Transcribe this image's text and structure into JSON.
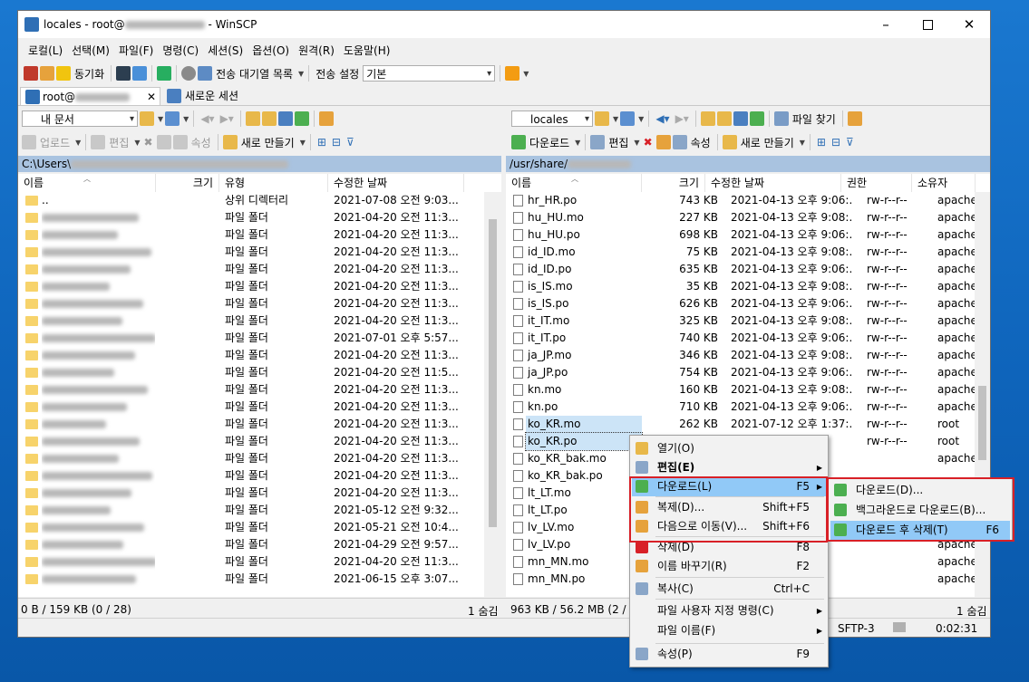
{
  "window": {
    "title_prefix": "locales - root@",
    "title_suffix": " - WinSCP",
    "min_icon": "minimize-icon",
    "max_icon": "maximize-icon",
    "close_icon": "close-icon"
  },
  "menubar": [
    "로컬(L)",
    "선택(M)",
    "파일(F)",
    "명령(C)",
    "세션(S)",
    "옵션(O)",
    "원격(R)",
    "도움말(H)"
  ],
  "toolbar": {
    "sync": "동기화",
    "queue": "전송 대기열 목록",
    "transfer_settings_label": "전송 설정",
    "transfer_settings_value": "기본"
  },
  "tabs": {
    "session": "root@",
    "new_session": "새로운 세션"
  },
  "left": {
    "location": "내 문서",
    "upload": "업로드",
    "edit": "편집",
    "properties": "속성",
    "new": "새로 만들기",
    "path": "C:\\Users\\",
    "headers": [
      "이름",
      "크기",
      "유형",
      "수정한 날짜"
    ],
    "rows": [
      {
        "name": "..",
        "type": "상위 디렉터리",
        "date": "2021-07-08  오전 9:03..."
      },
      {
        "name": "",
        "type": "파일 폴더",
        "date": "2021-04-20  오전 11:3..."
      },
      {
        "name": "",
        "type": "파일 폴더",
        "date": "2021-04-20  오전 11:3..."
      },
      {
        "name": "",
        "type": "파일 폴더",
        "date": "2021-04-20  오전 11:3..."
      },
      {
        "name": "",
        "type": "파일 폴더",
        "date": "2021-04-20  오전 11:3..."
      },
      {
        "name": "",
        "type": "파일 폴더",
        "date": "2021-04-20  오전 11:3..."
      },
      {
        "name": "",
        "type": "파일 폴더",
        "date": "2021-04-20  오전 11:3..."
      },
      {
        "name": "",
        "type": "파일 폴더",
        "date": "2021-04-20  오전 11:3..."
      },
      {
        "name": "",
        "type": "파일 폴더",
        "date": "2021-07-01  오후 5:57..."
      },
      {
        "name": "",
        "type": "파일 폴더",
        "date": "2021-04-20  오전 11:3..."
      },
      {
        "name": "",
        "type": "파일 폴더",
        "date": "2021-04-20  오전 11:5..."
      },
      {
        "name": "",
        "type": "파일 폴더",
        "date": "2021-04-20  오전 11:3..."
      },
      {
        "name": "",
        "type": "파일 폴더",
        "date": "2021-04-20  오전 11:3..."
      },
      {
        "name": "",
        "type": "파일 폴더",
        "date": "2021-04-20  오전 11:3..."
      },
      {
        "name": "",
        "type": "파일 폴더",
        "date": "2021-04-20  오전 11:3..."
      },
      {
        "name": "",
        "type": "파일 폴더",
        "date": "2021-04-20  오전 11:3..."
      },
      {
        "name": "",
        "type": "파일 폴더",
        "date": "2021-04-20  오전 11:3..."
      },
      {
        "name": "",
        "type": "파일 폴더",
        "date": "2021-04-20  오전 11:3..."
      },
      {
        "name": "",
        "type": "파일 폴더",
        "date": "2021-05-12  오전 9:32..."
      },
      {
        "name": "",
        "type": "파일 폴더",
        "date": "2021-05-21  오전 10:4..."
      },
      {
        "name": "",
        "type": "파일 폴더",
        "date": "2021-04-29  오전 9:57..."
      },
      {
        "name": "",
        "type": "파일 폴더",
        "date": "2021-04-20  오전 11:3..."
      },
      {
        "name": "",
        "type": "파일 폴더",
        "date": "2021-06-15  오후 3:07..."
      }
    ],
    "status": "0 B / 159 KB (0 / 28)",
    "hidden": "1 숨김"
  },
  "right": {
    "location": "locales",
    "find": "파일 찾기",
    "download": "다운로드",
    "edit": "편집",
    "properties": "속성",
    "new": "새로 만들기",
    "path": "/usr/share/",
    "headers": [
      "이름",
      "크기",
      "수정한 날짜",
      "권한",
      "소유자"
    ],
    "rows": [
      {
        "name": "hr_HR.po",
        "size": "743 KB",
        "date": "2021-04-13  오후 9:06:...",
        "perm": "rw-r--r--",
        "owner": "apache"
      },
      {
        "name": "hu_HU.mo",
        "size": "227 KB",
        "date": "2021-04-13  오후 9:08:...",
        "perm": "rw-r--r--",
        "owner": "apache"
      },
      {
        "name": "hu_HU.po",
        "size": "698 KB",
        "date": "2021-04-13  오후 9:06:...",
        "perm": "rw-r--r--",
        "owner": "apache"
      },
      {
        "name": "id_ID.mo",
        "size": "75 KB",
        "date": "2021-04-13  오후 9:08:...",
        "perm": "rw-r--r--",
        "owner": "apache"
      },
      {
        "name": "id_ID.po",
        "size": "635 KB",
        "date": "2021-04-13  오후 9:06:...",
        "perm": "rw-r--r--",
        "owner": "apache"
      },
      {
        "name": "is_IS.mo",
        "size": "35 KB",
        "date": "2021-04-13  오후 9:08:...",
        "perm": "rw-r--r--",
        "owner": "apache"
      },
      {
        "name": "is_IS.po",
        "size": "626 KB",
        "date": "2021-04-13  오후 9:06:...",
        "perm": "rw-r--r--",
        "owner": "apache"
      },
      {
        "name": "it_IT.mo",
        "size": "325 KB",
        "date": "2021-04-13  오후 9:08:...",
        "perm": "rw-r--r--",
        "owner": "apache"
      },
      {
        "name": "it_IT.po",
        "size": "740 KB",
        "date": "2021-04-13  오후 9:06:...",
        "perm": "rw-r--r--",
        "owner": "apache"
      },
      {
        "name": "ja_JP.mo",
        "size": "346 KB",
        "date": "2021-04-13  오후 9:08:...",
        "perm": "rw-r--r--",
        "owner": "apache"
      },
      {
        "name": "ja_JP.po",
        "size": "754 KB",
        "date": "2021-04-13  오후 9:06:...",
        "perm": "rw-r--r--",
        "owner": "apache"
      },
      {
        "name": "kn.mo",
        "size": "160 KB",
        "date": "2021-04-13  오후 9:08:...",
        "perm": "rw-r--r--",
        "owner": "apache"
      },
      {
        "name": "kn.po",
        "size": "710 KB",
        "date": "2021-04-13  오후 9:06:...",
        "perm": "rw-r--r--",
        "owner": "apache"
      },
      {
        "name": "ko_KR.mo",
        "size": "262 KB",
        "date": "2021-07-12  오후 1:37:...",
        "perm": "rw-r--r--",
        "owner": "root"
      },
      {
        "name": "ko_KR.po",
        "size": "",
        "date": "",
        "perm": "rw-r--r--",
        "owner": "root"
      },
      {
        "name": "ko_KR_bak.mo",
        "size": "",
        "date": "",
        "perm": "",
        "owner": "apache"
      },
      {
        "name": "ko_KR_bak.po",
        "size": "",
        "date": "",
        "perm": "",
        "owner": ""
      },
      {
        "name": "lt_LT.mo",
        "size": "",
        "date": "",
        "perm": "",
        "owner": ""
      },
      {
        "name": "lt_LT.po",
        "size": "",
        "date": "",
        "perm": "",
        "owner": ""
      },
      {
        "name": "lv_LV.mo",
        "size": "",
        "date": "",
        "perm": "",
        "owner": "apache"
      },
      {
        "name": "lv_LV.po",
        "size": "",
        "date": "",
        "perm": "",
        "owner": "apache"
      },
      {
        "name": "mn_MN.mo",
        "size": "",
        "date": "",
        "perm": "",
        "owner": "apache"
      },
      {
        "name": "mn_MN.po",
        "size": "",
        "date": "",
        "perm": "",
        "owner": "apache"
      }
    ],
    "status": "963 KB / 56.2 MB (2 / 1",
    "hidden": "1 숨김",
    "protocol": "SFTP-3",
    "time": "0:02:31"
  },
  "context_menu": [
    {
      "label": "열기(O)",
      "key": "",
      "arrow": false,
      "icon": "open-folder-icon"
    },
    {
      "label": "편집(E)",
      "key": "",
      "arrow": true,
      "icon": "edit-icon",
      "bold": true
    },
    {
      "label": "다운로드(L)",
      "key": "F5",
      "arrow": true,
      "icon": "download-icon",
      "highlight": true
    },
    {
      "label": "복제(D)...",
      "key": "Shift+F5",
      "arrow": false,
      "icon": "duplicate-icon"
    },
    {
      "label": "다음으로 이동(V)...",
      "key": "Shift+F6",
      "arrow": false,
      "icon": "move-icon"
    },
    {
      "label": "삭제(D)",
      "key": "F8",
      "arrow": false,
      "icon": "delete-icon"
    },
    {
      "label": "이름 바꾸기(R)",
      "key": "F2",
      "arrow": false,
      "icon": "rename-icon"
    },
    {
      "label": "복사(C)",
      "key": "Ctrl+C",
      "arrow": false,
      "icon": "copy-icon"
    },
    {
      "label": "파일 사용자 지정 명령(C)",
      "key": "",
      "arrow": true,
      "icon": ""
    },
    {
      "label": "파일 이름(F)",
      "key": "",
      "arrow": true,
      "icon": ""
    },
    {
      "label": "속성(P)",
      "key": "F9",
      "arrow": false,
      "icon": "properties-icon"
    }
  ],
  "submenu": [
    {
      "label": "다운로드(D)...",
      "key": ""
    },
    {
      "label": "백그라운드로 다운로드(B)...",
      "key": ""
    },
    {
      "label": "다운로드 후 삭제(T)",
      "key": "F6"
    }
  ]
}
